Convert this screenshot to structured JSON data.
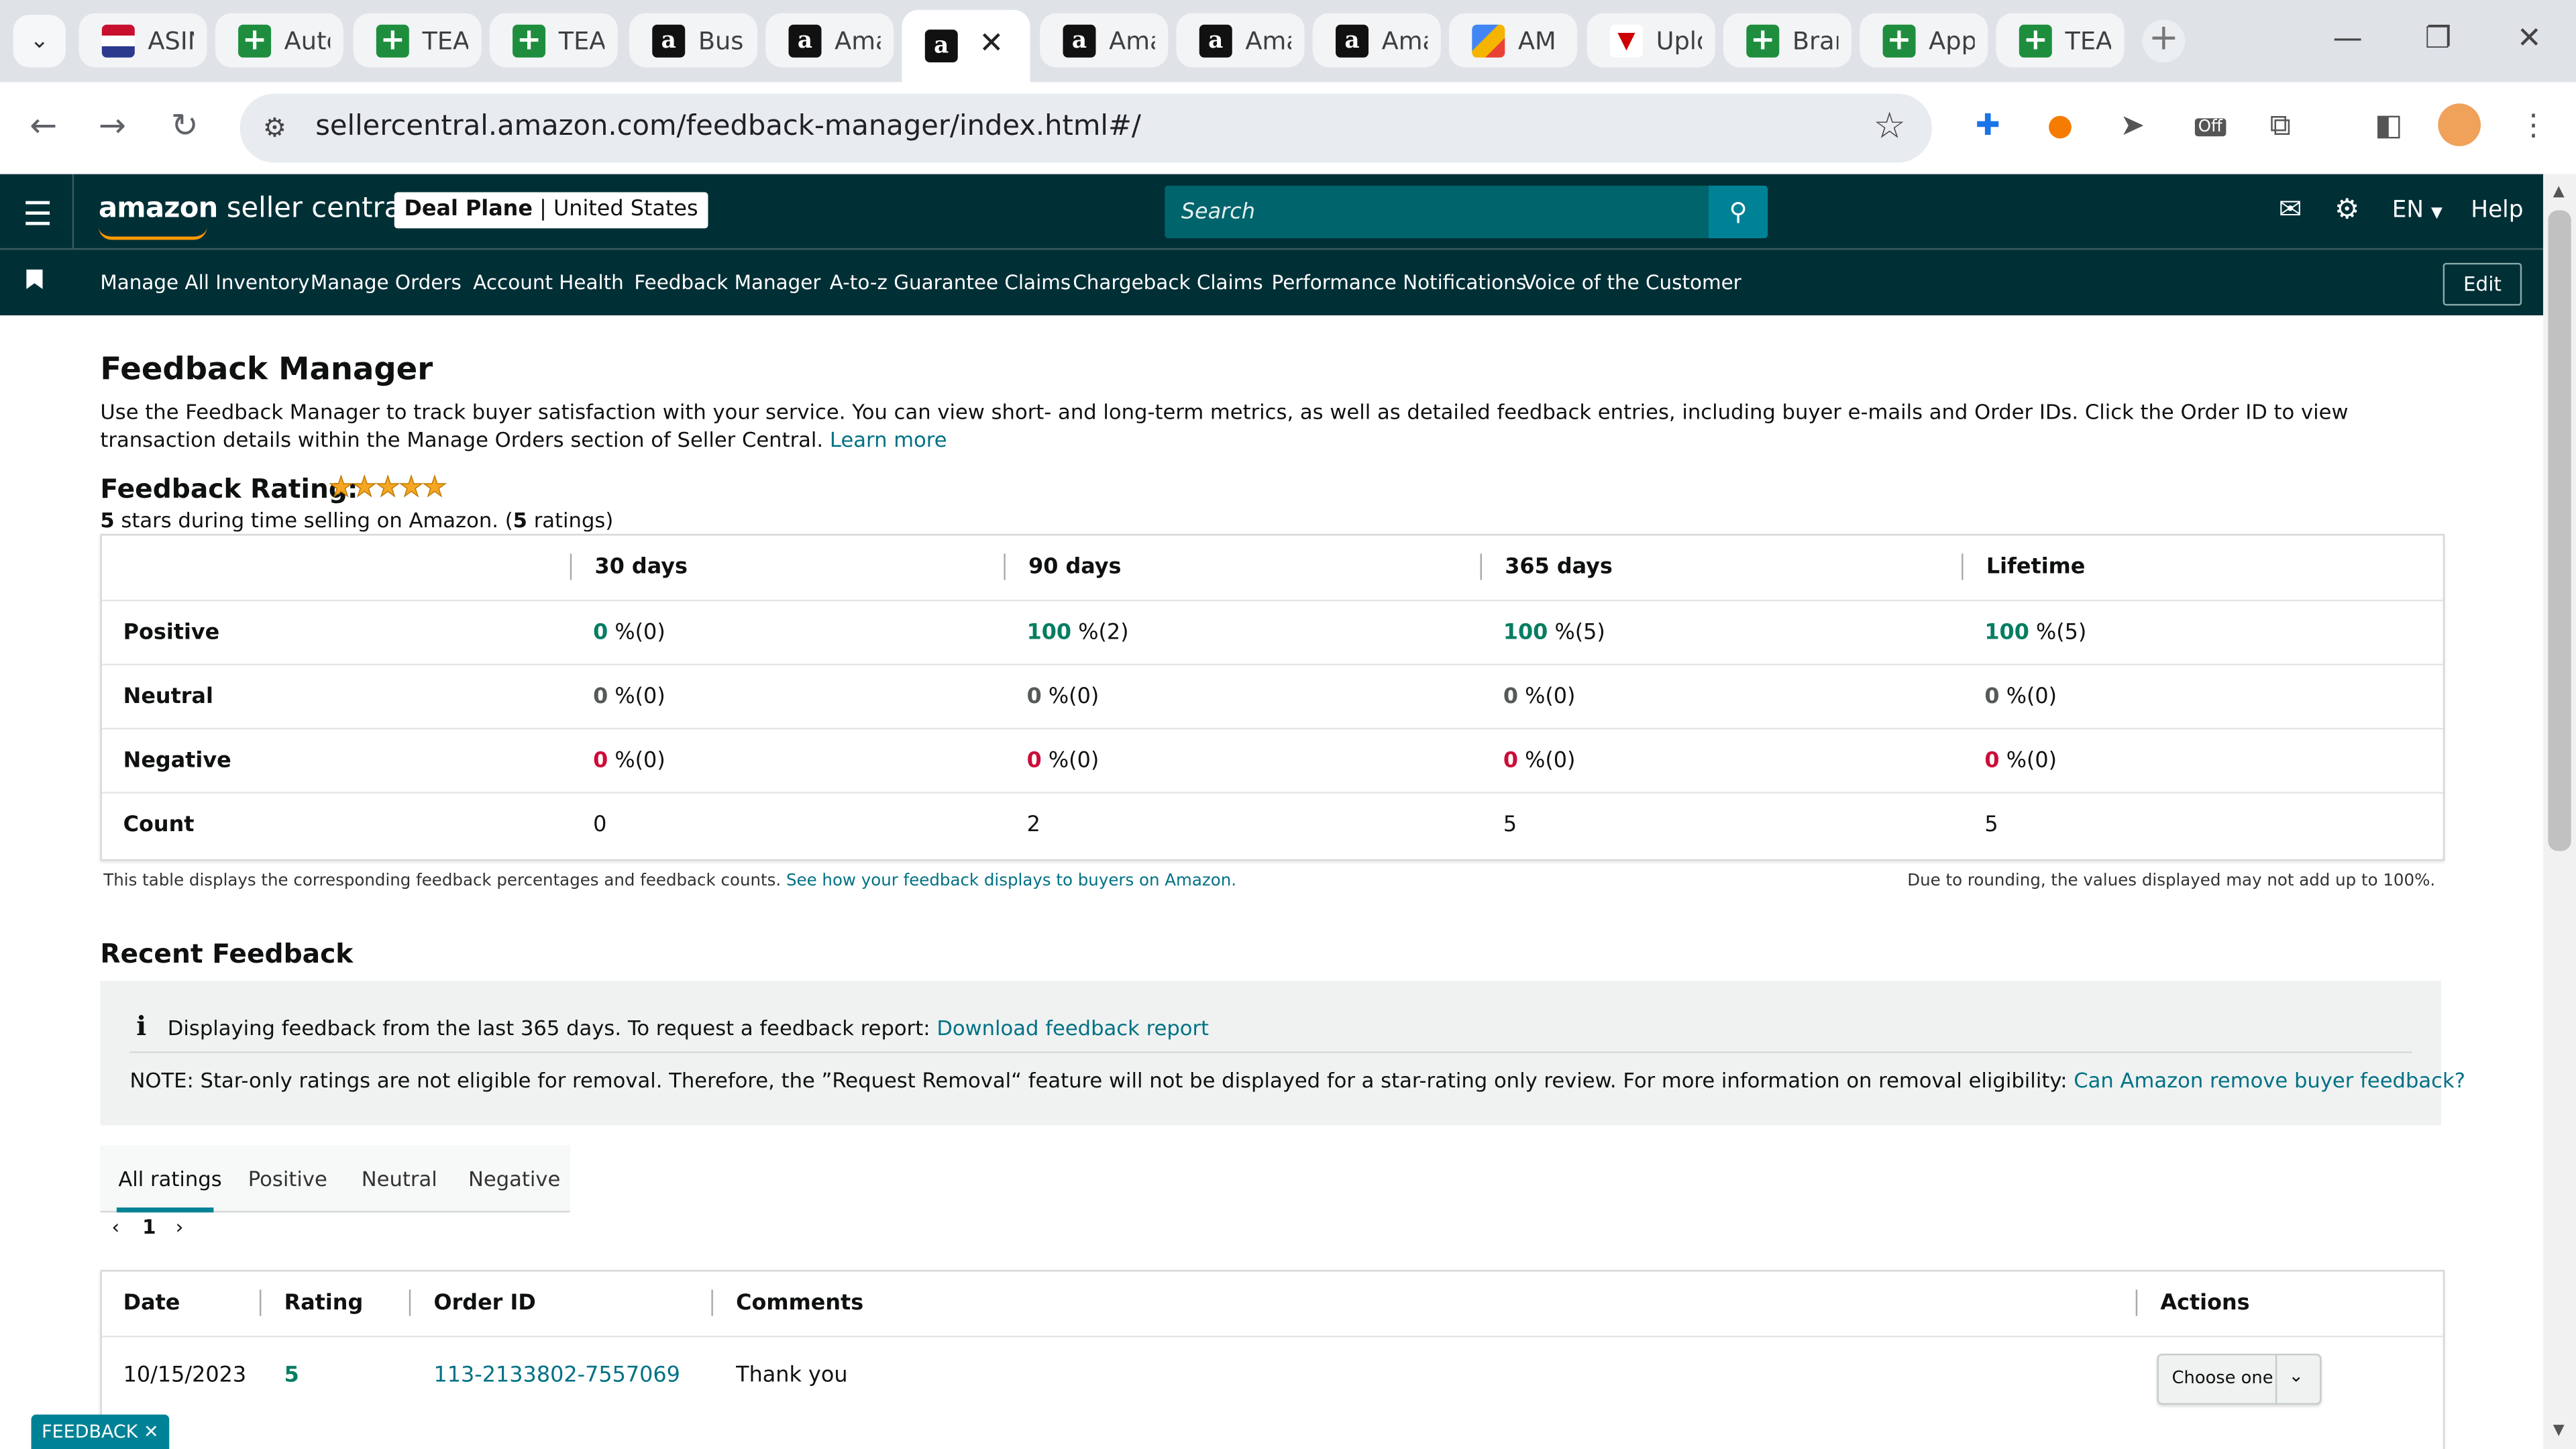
{
  "browser": {
    "tabs": [
      {
        "label": "ASIN",
        "icon": "flag-icon"
      },
      {
        "label": "Auto",
        "icon": "sheets-icon"
      },
      {
        "label": "TEA",
        "icon": "sheets-icon"
      },
      {
        "label": "TEA",
        "icon": "sheets-icon"
      },
      {
        "label": "Busi",
        "icon": "amazon-icon"
      },
      {
        "label": "Ama",
        "icon": "amazon-icon"
      },
      {
        "label": "",
        "icon": "amazon-icon",
        "active": true
      },
      {
        "label": "Ama",
        "icon": "amazon-icon"
      },
      {
        "label": "Ama",
        "icon": "amazon-icon"
      },
      {
        "label": "Ama",
        "icon": "amazon-icon"
      },
      {
        "label": "AM",
        "icon": "multi-icon"
      },
      {
        "label": "Uplo",
        "icon": "red-icon"
      },
      {
        "label": "Bran",
        "icon": "sheets-icon"
      },
      {
        "label": "App",
        "icon": "sheets-icon"
      },
      {
        "label": "TEA",
        "icon": "sheets-icon"
      }
    ],
    "url": "sellercentral.amazon.com/feedback-manager/index.html#/",
    "extension_badge": "Off"
  },
  "header": {
    "logo_amazon": "amazon",
    "logo_rest": " seller central",
    "account_name": "Deal Plane",
    "account_region": "United States",
    "search_placeholder": "Search",
    "language": "EN",
    "help": "Help"
  },
  "nav": {
    "items": [
      "Manage All Inventory",
      "Manage Orders",
      "Account Health",
      "Feedback Manager",
      "A-to-z Guarantee Claims",
      "Chargeback Claims",
      "Performance Notifications",
      "Voice of the Customer"
    ],
    "edit": "Edit"
  },
  "page": {
    "title": "Feedback Manager",
    "intro": "Use the Feedback Manager to track buyer satisfaction with your service. You can view short- and long-term metrics, as well as detailed feedback entries, including buyer e-mails and Order IDs. Click the Order ID to view transaction details within the Manage Orders section of Seller Central.",
    "learn_more": "Learn more",
    "rating_label": "Feedback Rating:",
    "stars": "★★★★★",
    "rating_value": "5",
    "rating_mid": " stars during time selling on Amazon. (",
    "rating_count": "5",
    "rating_end": " ratings)"
  },
  "summary_table": {
    "columns": [
      "30 days",
      "90 days",
      "365 days",
      "Lifetime"
    ],
    "rows": [
      {
        "label": "Positive",
        "values": [
          [
            "0",
            "%(0)"
          ],
          [
            "100",
            "%(2)"
          ],
          [
            "100",
            "%(5)"
          ],
          [
            "100",
            "%(5)"
          ]
        ]
      },
      {
        "label": "Neutral",
        "values": [
          [
            "0",
            "%(0)"
          ],
          [
            "0",
            "%(0)"
          ],
          [
            "0",
            "%(0)"
          ],
          [
            "0",
            "%(0)"
          ]
        ]
      },
      {
        "label": "Negative",
        "values": [
          [
            "0",
            "%(0)"
          ],
          [
            "0",
            "%(0)"
          ],
          [
            "0",
            "%(0)"
          ],
          [
            "0",
            "%(0)"
          ]
        ]
      },
      {
        "label": "Count",
        "values": [
          [
            "0",
            ""
          ],
          [
            "2",
            ""
          ],
          [
            "5",
            ""
          ],
          [
            "5",
            ""
          ]
        ]
      }
    ],
    "footnote": "This table displays the corresponding feedback percentages and feedback counts.",
    "footnote_link": "See how your feedback displays to buyers on Amazon.",
    "rounding_note": "Due to rounding, the values displayed may not add up to 100%."
  },
  "recent": {
    "title": "Recent Feedback",
    "info_line": "Displaying feedback from the last 365 days. To request a feedback report:",
    "info_link": "Download feedback report",
    "note": "NOTE: Star-only ratings are not eligible for removal. Therefore, the ”Request Removal“ feature will not be displayed for a star-rating only review. For more information on removal eligibility:",
    "note_link": "Can Amazon remove buyer feedback?",
    "filters": [
      "All ratings",
      "Positive",
      "Neutral",
      "Negative"
    ],
    "page": "1",
    "columns": [
      "Date",
      "Rating",
      "Order ID",
      "Comments",
      "Actions"
    ],
    "entries": [
      {
        "date": "10/15/2023",
        "rating": "5",
        "order_id": "113-2133802-7557069",
        "comment": "Thank you",
        "action": "Choose one"
      }
    ]
  },
  "feedback_tab": "FEEDBACK",
  "colors": {
    "header_bg": "#002f36",
    "link": "#007185",
    "positive": "#067d62",
    "negative": "#cc0c39",
    "accent": "#008296"
  }
}
